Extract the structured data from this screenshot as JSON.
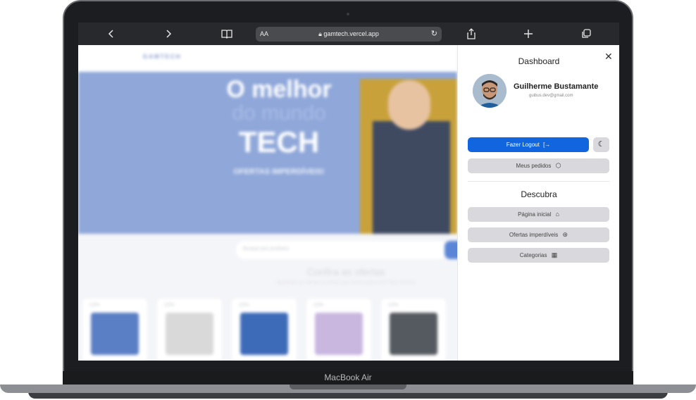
{
  "device": {
    "label": "MacBook Air"
  },
  "browser": {
    "text_size_label": "AA",
    "url": "gamtech.vercel.app",
    "icons": [
      "chevron-left-icon",
      "chevron-right-icon",
      "book-icon",
      "lock-icon",
      "reload-icon",
      "share-icon",
      "plus-icon",
      "tabs-icon"
    ]
  },
  "background_page": {
    "logo": "GAMTECH",
    "hero": {
      "line1": "O melhor",
      "line2": "do mundo",
      "line3": "TECH",
      "tagline": "OFERTAS IMPERDÍVEIS!"
    },
    "search_placeholder": "Busque por produtos",
    "section_title": "Confira as ofertas",
    "section_subtitle": "Aproveite as ofertas incríveis que temos para você hoje mesmo",
    "products": [
      {
        "badge": "-10%",
        "color": "#5b7fc4"
      },
      {
        "badge": "-10%",
        "color": "#d9d9d9"
      },
      {
        "badge": "-15%",
        "color": "#3e6bb8"
      },
      {
        "badge": "-10%",
        "color": "#c9b7e0"
      },
      {
        "badge": "-10%",
        "color": "#555a60"
      }
    ]
  },
  "panel": {
    "title": "Dashboard",
    "user": {
      "name": "Guilherme Bustamante",
      "email": "guibus.dev@gmail.com"
    },
    "logout_label": "Fazer Logout",
    "orders_label": "Meus pedidos",
    "discover_title": "Descubra",
    "discover_items": [
      {
        "label": "Página inicial",
        "icon": "home-icon"
      },
      {
        "label": "Ofertas imperdíveis",
        "icon": "percent-badge-icon"
      },
      {
        "label": "Categorias",
        "icon": "grid-icon"
      }
    ]
  },
  "colors": {
    "accent": "#1166e0",
    "panel_button": "#d9d9dd"
  }
}
